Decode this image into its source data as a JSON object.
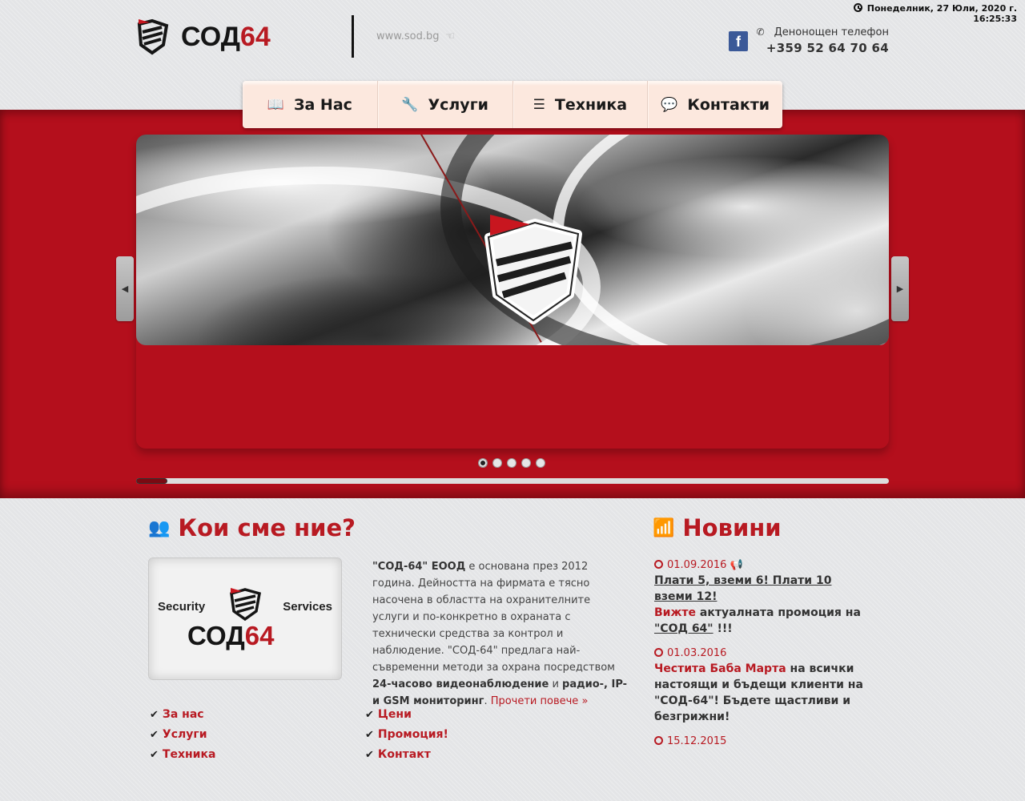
{
  "header": {
    "datetime_line1": "Понеделник, 27 Юли, 2020 г.",
    "datetime_line2": "16:25:33",
    "brand_main": "СОД",
    "brand_num": "64",
    "site_url": "www.sod.bg",
    "facebook_label": "f",
    "phone_label": "Денонощен телефон",
    "phone_number": "+359 52 64 70 64"
  },
  "nav": {
    "items": [
      {
        "label": "За Нас",
        "icon": "book-icon"
      },
      {
        "label": "Услуги",
        "icon": "wrench-icon"
      },
      {
        "label": "Техника",
        "icon": "server-icon"
      },
      {
        "label": "Контакти",
        "icon": "comment-icon"
      }
    ]
  },
  "slider": {
    "prev_label": "◀",
    "next_label": "▶",
    "dots_count": 5,
    "active_dot": 0,
    "progress": 0.042
  },
  "about": {
    "title": "Кои сме ние?",
    "box_left_word": "Security",
    "box_right_word": "Services",
    "text_bold_company": "\"СОД-64\" ЕООД",
    "text_p1": " е основана през 2012 година. Дейността на фирмата е тясно насочена в областта на охранителните услуги и по-конкретно в охраната с технически средства за контрол и наблюдение. \"СОД-64\" предлага най-съвременни методи за охрана посредством ",
    "text_bold_1": "24-часово видеонаблюдение",
    "text_and": " и ",
    "text_bold_2": "радио-, IP- и GSM мониторинг",
    "text_dot": ". ",
    "read_more": "Прочети повече »",
    "links_left": [
      "За нас",
      "Услуги",
      "Техника"
    ],
    "links_right": [
      "Цени",
      "Промоция!",
      "Контакт"
    ]
  },
  "news": {
    "title": "Новини",
    "items": [
      {
        "date": "01.09.2016",
        "headline": "Плати 5, вземи 6! Плати 10 вземи 12!",
        "see": "Вижте",
        "text": " актуалната промоция на ",
        "brand": "\"СОД 64\"",
        "end": " !!!"
      },
      {
        "date": "01.03.2016",
        "highlight": "Честита Баба Марта",
        "text": " на всички настоящи и бъдещи клиенти на \"СОД-64\"! Бъдете щастливи и безгрижни!"
      },
      {
        "date": "15.12.2015"
      }
    ]
  }
}
